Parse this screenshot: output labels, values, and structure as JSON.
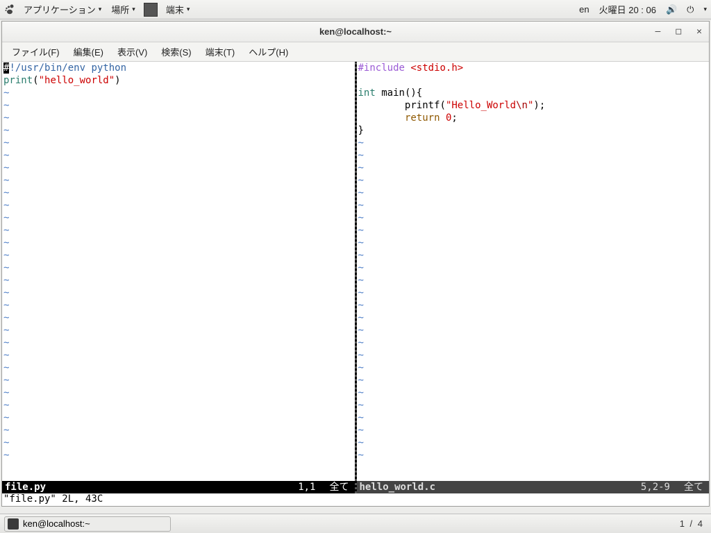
{
  "topbar": {
    "apps": "アプリケーション",
    "places": "場所",
    "active_app": "端末",
    "input_method": "en",
    "clock": "火曜日 20 : 06"
  },
  "window": {
    "title": "ken@localhost:~"
  },
  "menubar": {
    "file": "ファイル(F)",
    "edit": "編集(E)",
    "view": "表示(V)",
    "search": "検索(S)",
    "terminal": "端末(T)",
    "help": "ヘルプ(H)"
  },
  "left_pane": {
    "line1_pre": "#",
    "line1_rest": "!/usr/bin/env python",
    "line2_fn": "print",
    "line2_paren_open": "(",
    "line2_str": "\"hello_world\"",
    "line2_paren_close": ")"
  },
  "right_pane": {
    "l1_inc": "#include ",
    "l1_hdr": "<stdio.h>",
    "l3_int": "int",
    "l3_rest": " main(){",
    "l4_indent": "        printf(",
    "l4_str": "\"Hello_World",
    "l4_esc": "\\n",
    "l4_end": "\");",
    "l5_indent": "        ",
    "l5_ret": "return",
    "l5_zero": " 0",
    "l5_semi": ";",
    "l6": "}"
  },
  "status_left": {
    "filename": "file.py",
    "pos": "1,1",
    "tail": "全て"
  },
  "status_right": {
    "filename": "hello_world.c",
    "pos": "5,2-9",
    "tail": "全て"
  },
  "cmdline": "\"file.py\" 2L, 43C",
  "taskbar": {
    "app": "ken@localhost:~",
    "workspace": "1 / 4"
  }
}
